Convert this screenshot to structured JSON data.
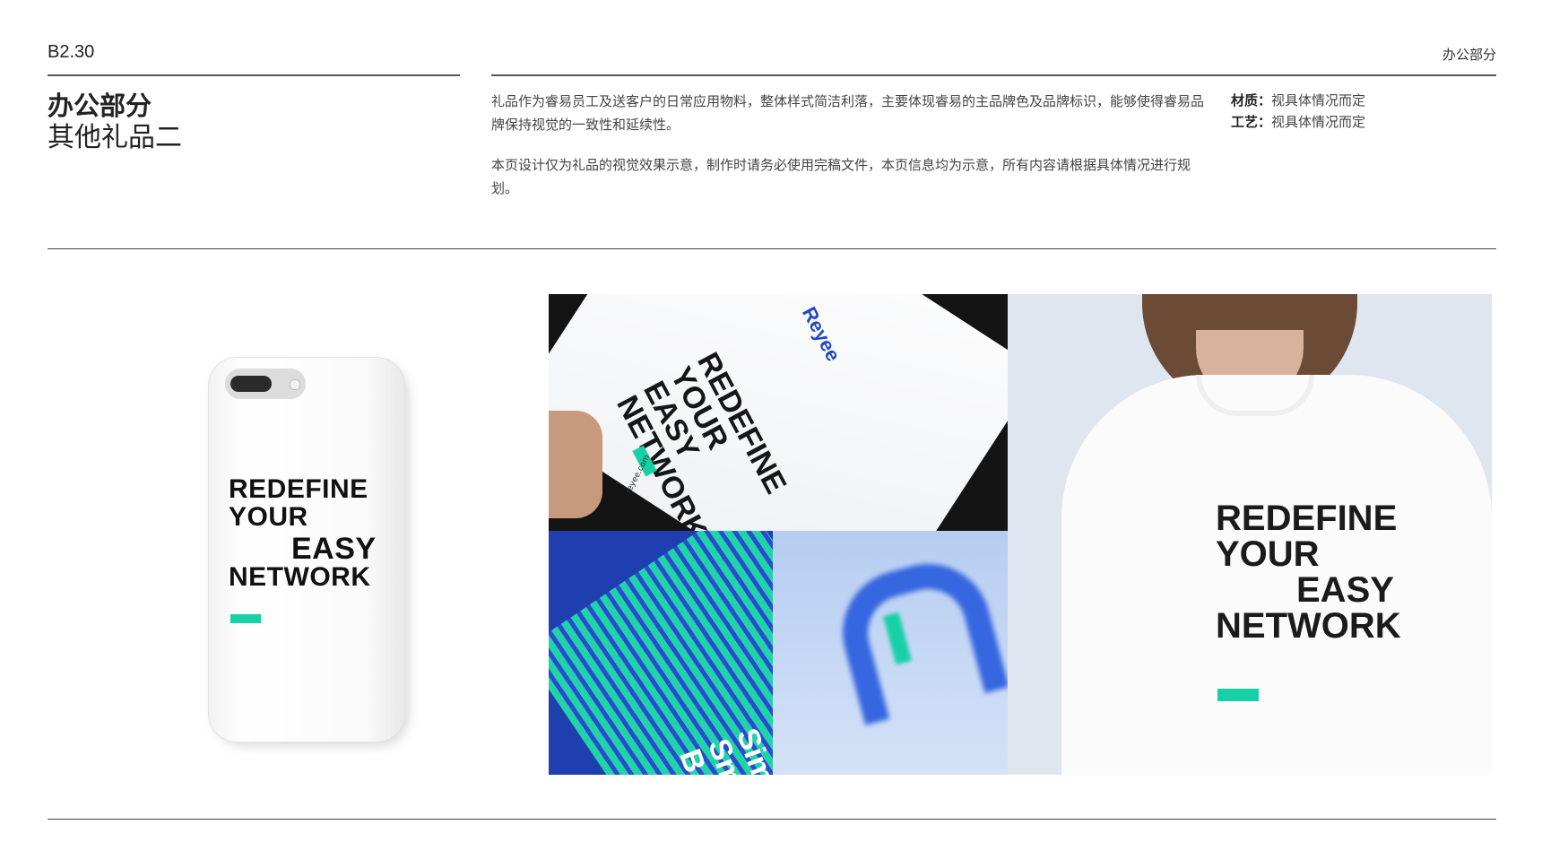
{
  "header": {
    "page_number": "B2.30",
    "section_tag": "办公部分"
  },
  "title": {
    "main": "办公部分",
    "sub": "其他礼品二"
  },
  "description": {
    "paragraph1": "礼品作为睿易员工及送客户的日常应用物料，整体样式简洁利落，主要体现睿易的主品牌色及品牌标识，能够使得睿易品牌保持视觉的一致性和延续性。",
    "paragraph2": "本页设计仅为礼品的视觉效果示意，制作时请务必使用完稿文件，本页信息均为示意，所有内容请根据具体情况进行规划。"
  },
  "specs": {
    "material_label": "材质：",
    "material_value": "视具体情况而定",
    "process_label": "工艺：",
    "process_value": "视具体情况而定"
  },
  "phone_case": {
    "line1": "REDEFINE",
    "line2": "YOUR",
    "line3": "EASY",
    "line4": "NETWORK"
  },
  "booklet": {
    "brand": "Reyee",
    "slogan": "REDEFINE\nYOUR\nEASY\nNETWORK",
    "url": "reyee.com"
  },
  "card": {
    "text": "Sim\nSm\nB"
  },
  "tshirt": {
    "line1": "REDEFINE",
    "line2": "YOUR",
    "line3": "EASY",
    "line4": "NETWORK"
  },
  "colors": {
    "brand_teal": "#17d0a5",
    "brand_blue": "#2148c4"
  }
}
